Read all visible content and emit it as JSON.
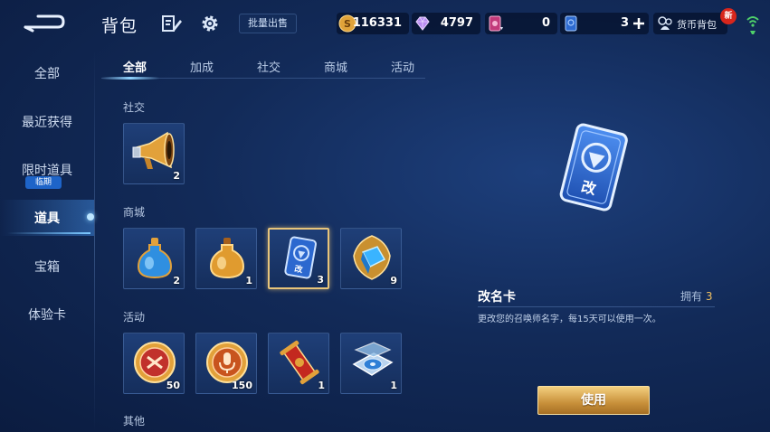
{
  "header": {
    "title": "背包",
    "bulk_sell_label": "批量出售",
    "currencies": {
      "gold": "116331",
      "diamond": "4797",
      "ticket": "0",
      "card": "3"
    },
    "wallet_label": "货币背包",
    "new_badge": "新"
  },
  "sidebar": {
    "items": [
      {
        "label": "全部"
      },
      {
        "label": "最近获得"
      },
      {
        "label": "限时道具"
      },
      {
        "label": "道具"
      },
      {
        "label": "宝箱"
      },
      {
        "label": "体验卡"
      }
    ],
    "limited_badge": "临期"
  },
  "tabs": [
    {
      "label": "全部"
    },
    {
      "label": "加成"
    },
    {
      "label": "社交"
    },
    {
      "label": "商城"
    },
    {
      "label": "活动"
    }
  ],
  "sections": {
    "social": {
      "label": "社交",
      "items": [
        {
          "icon": "megaphone-icon",
          "count": "2"
        }
      ]
    },
    "shop": {
      "label": "商城",
      "items": [
        {
          "icon": "blue-potion-icon",
          "count": "2"
        },
        {
          "icon": "gold-potion-icon",
          "count": "1"
        },
        {
          "icon": "rename-card-icon",
          "count": "3"
        },
        {
          "icon": "crystal-box-icon",
          "count": "9"
        }
      ]
    },
    "event": {
      "label": "活动",
      "items": [
        {
          "icon": "battle-medal-icon",
          "count": "50"
        },
        {
          "icon": "microphone-medal-icon",
          "count": "150"
        },
        {
          "icon": "scroll-icon",
          "count": "1"
        },
        {
          "icon": "disc-case-icon",
          "count": "1"
        }
      ]
    },
    "other": {
      "label": "其他"
    }
  },
  "detail": {
    "name": "改名卡",
    "own_label": "拥有",
    "own_count": "3",
    "description": "更改您的召唤师名字，每15天可以使用一次。",
    "card_char": "改",
    "use_label": "使用"
  },
  "colors": {
    "accent_gold": "#e7c47a",
    "active_blue": "#8fd3ff",
    "background": "#122a58"
  }
}
